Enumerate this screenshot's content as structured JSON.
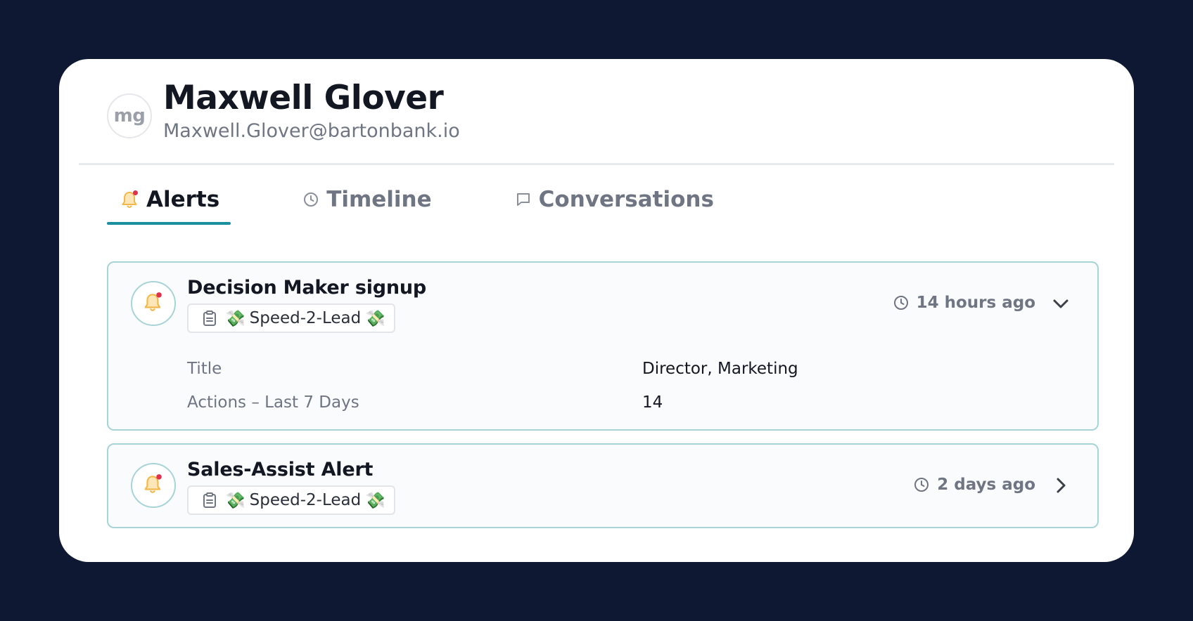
{
  "profile": {
    "initials": "mg",
    "name": "Maxwell Glover",
    "email": "Maxwell.Glover@bartonbank.io"
  },
  "tabs": [
    {
      "label": "Alerts",
      "icon": "bell-icon",
      "active": true
    },
    {
      "label": "Timeline",
      "icon": "clock-icon",
      "active": false
    },
    {
      "label": "Conversations",
      "icon": "chat-bubble-icon",
      "active": false
    }
  ],
  "alerts": [
    {
      "title": "Decision Maker signup",
      "tag": {
        "label": "Speed-2-Lead",
        "prefix": "💸",
        "suffix": "💸",
        "icon": "clipboard-icon"
      },
      "time": "14 hours ago",
      "expanded": true,
      "toggle_icon": "chevron-down-icon",
      "details": [
        {
          "label": "Title",
          "value": "Director, Marketing"
        },
        {
          "label": "Actions – Last 7 Days",
          "value": "14"
        }
      ]
    },
    {
      "title": "Sales-Assist Alert",
      "tag": {
        "label": "Speed-2-Lead",
        "prefix": "💸",
        "suffix": "💸",
        "icon": "clipboard-icon"
      },
      "time": "2 days ago",
      "expanded": false,
      "toggle_icon": "chevron-right-icon"
    }
  ],
  "colors": {
    "background": "#0e1833",
    "accent": "#1a8f9d",
    "alert_border": "#a8d3d7",
    "notification_dot": "#e0314b",
    "bell": "#f2b84b"
  }
}
